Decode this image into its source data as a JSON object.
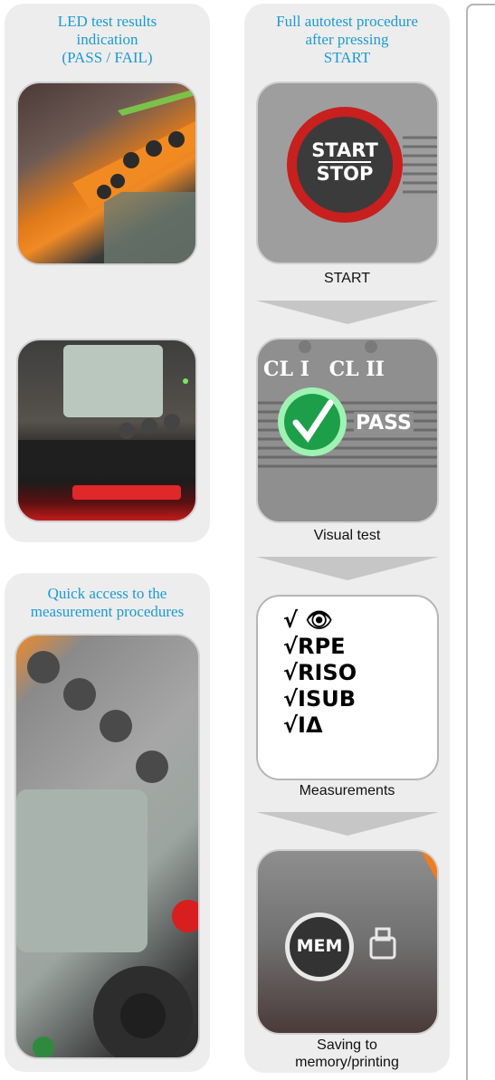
{
  "left_top_panel": {
    "heading": [
      "LED test results",
      "indication",
      "(PASS / FAIL)"
    ]
  },
  "left_bottom_panel": {
    "heading": [
      "Quick access to the",
      "measurement procedures"
    ]
  },
  "right_panel": {
    "heading": [
      "Full autotest procedure",
      "after pressing",
      "START"
    ],
    "steps": [
      {
        "caption": "START",
        "button_text": [
          "START",
          "STOP"
        ]
      },
      {
        "caption": "Visual test",
        "labels": [
          "CL I",
          "CL II",
          "PASS"
        ]
      },
      {
        "caption": "Measurements",
        "items": [
          "👁",
          "RPE",
          "RISO",
          "ISUB",
          "IΔ"
        ]
      },
      {
        "caption_lines": [
          "Saving to",
          "memory/printing"
        ],
        "button_text": "MEM"
      }
    ]
  }
}
